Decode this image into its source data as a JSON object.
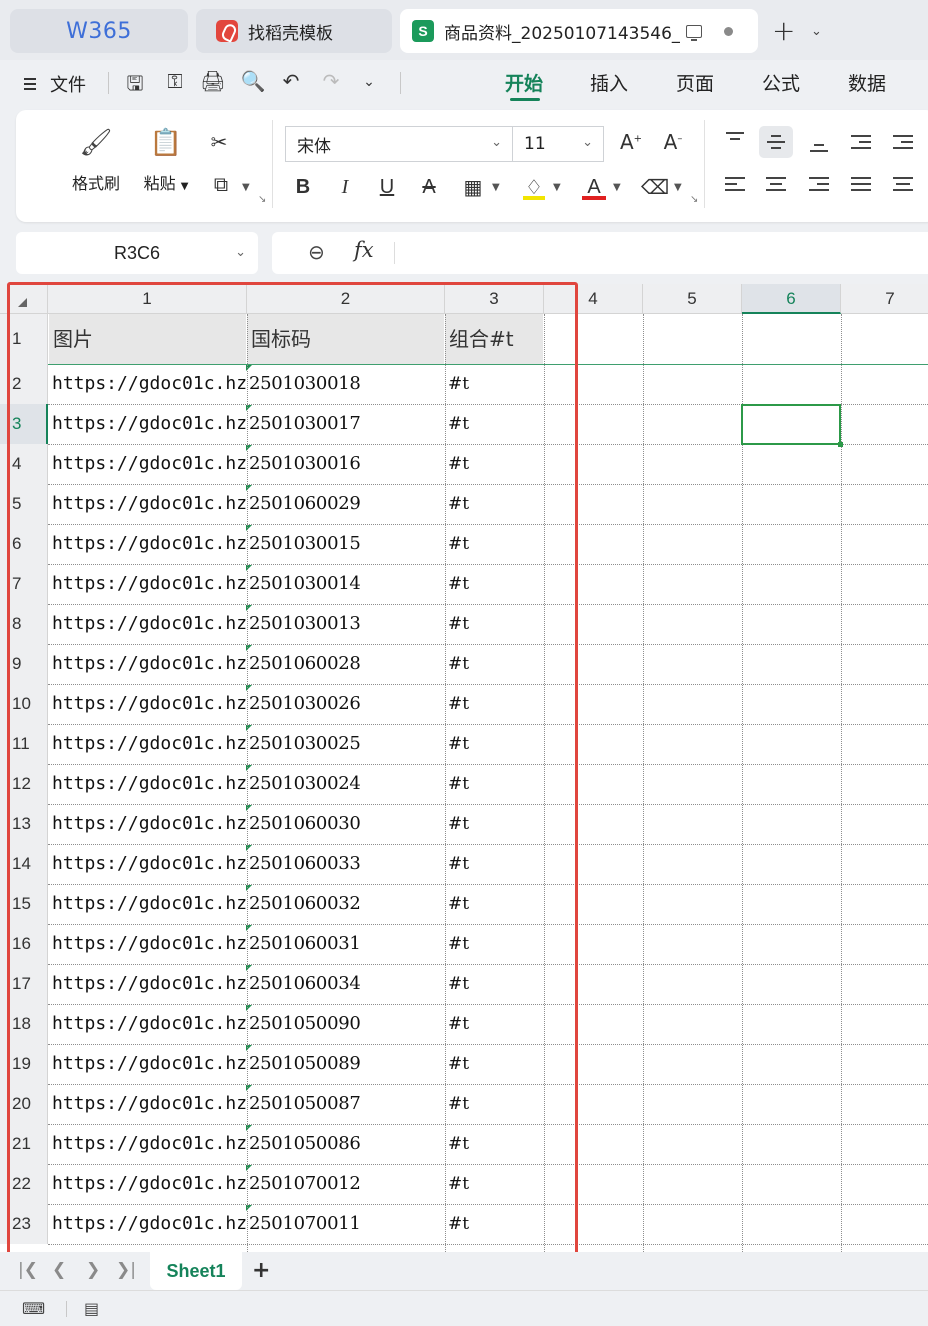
{
  "tabs": {
    "w365_logo": "W365",
    "template_tab": "找稻壳模板",
    "sheet_tab": "商品资料_20250107143546_"
  },
  "menu": {
    "file_label": "文件",
    "ribbon_tabs": [
      "开始",
      "插入",
      "页面",
      "公式",
      "数据"
    ],
    "active_tab": "开始"
  },
  "ribbon": {
    "format_painter": "格式刷",
    "paste": "粘贴",
    "font_name": "宋体",
    "font_size": "11",
    "highlight_color": "#f2e500",
    "font_color": "#e02020"
  },
  "namebox": {
    "ref": "R3C6"
  },
  "formula": {
    "fx": "fx",
    "value": ""
  },
  "grid": {
    "column_headers": [
      "1",
      "2",
      "3",
      "4",
      "5",
      "6",
      "7"
    ],
    "selected_column": "6",
    "header_row": [
      "图片",
      "国标码",
      "组合#t"
    ],
    "rows": [
      {
        "n": "2",
        "url": "https://gdoc01c.hz",
        "code": "2501030018",
        "tag": "#t"
      },
      {
        "n": "3",
        "url": "https://gdoc01c.hz",
        "code": "2501030017",
        "tag": "#t"
      },
      {
        "n": "4",
        "url": "https://gdoc01c.hz",
        "code": "2501030016",
        "tag": "#t"
      },
      {
        "n": "5",
        "url": "https://gdoc01c.hz",
        "code": "2501060029",
        "tag": "#t"
      },
      {
        "n": "6",
        "url": "https://gdoc01c.hz",
        "code": "2501030015",
        "tag": "#t"
      },
      {
        "n": "7",
        "url": "https://gdoc01c.hz",
        "code": "2501030014",
        "tag": "#t"
      },
      {
        "n": "8",
        "url": "https://gdoc01c.hz",
        "code": "2501030013",
        "tag": "#t"
      },
      {
        "n": "9",
        "url": "https://gdoc01c.hz",
        "code": "2501060028",
        "tag": "#t"
      },
      {
        "n": "10",
        "url": "https://gdoc01c.hz",
        "code": "2501030026",
        "tag": "#t"
      },
      {
        "n": "11",
        "url": "https://gdoc01c.hz",
        "code": "2501030025",
        "tag": "#t"
      },
      {
        "n": "12",
        "url": "https://gdoc01c.hz",
        "code": "2501030024",
        "tag": "#t"
      },
      {
        "n": "13",
        "url": "https://gdoc01c.hz",
        "code": "2501060030",
        "tag": "#t"
      },
      {
        "n": "14",
        "url": "https://gdoc01c.hz",
        "code": "2501060033",
        "tag": "#t"
      },
      {
        "n": "15",
        "url": "https://gdoc01c.hz",
        "code": "2501060032",
        "tag": "#t"
      },
      {
        "n": "16",
        "url": "https://gdoc01c.hz",
        "code": "2501060031",
        "tag": "#t"
      },
      {
        "n": "17",
        "url": "https://gdoc01c.hz",
        "code": "2501060034",
        "tag": "#t"
      },
      {
        "n": "18",
        "url": "https://gdoc01c.hz",
        "code": "2501050090",
        "tag": "#t"
      },
      {
        "n": "19",
        "url": "https://gdoc01c.hz",
        "code": "2501050089",
        "tag": "#t"
      },
      {
        "n": "20",
        "url": "https://gdoc01c.hz",
        "code": "2501050087",
        "tag": "#t"
      },
      {
        "n": "21",
        "url": "https://gdoc01c.hz",
        "code": "2501050086",
        "tag": "#t"
      },
      {
        "n": "22",
        "url": "https://gdoc01c.hz",
        "code": "2501070012",
        "tag": "#t"
      },
      {
        "n": "23",
        "url": "https://gdoc01c.hz",
        "code": "2501070011",
        "tag": "#t"
      }
    ],
    "active_row": "3",
    "accent_color": "#15835a"
  },
  "sheets": {
    "names": [
      "Sheet1"
    ],
    "active": "Sheet1"
  }
}
